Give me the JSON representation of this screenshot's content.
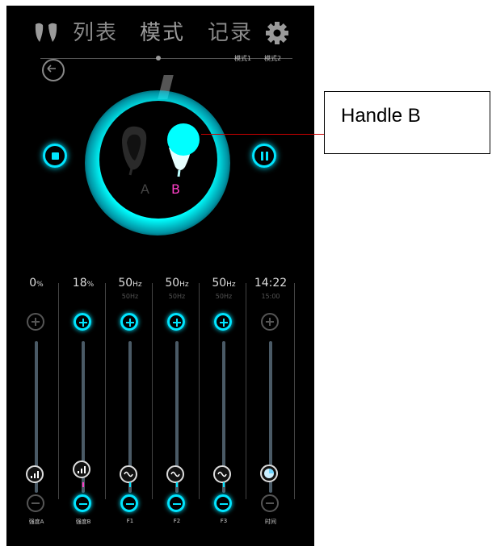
{
  "nav": {
    "tabs": [
      "列表",
      "模式",
      "记录"
    ],
    "active_tab": "模式"
  },
  "modes": [
    "模式1",
    "模式2"
  ],
  "handles": {
    "a": "A",
    "b": "B"
  },
  "colors": {
    "accent": "#00e5ff",
    "handle_b": "#ff3fc8",
    "background": "#000000"
  },
  "icons": {
    "logo": "handles-logo-icon",
    "settings": "gear-icon",
    "back": "back-arrow-icon",
    "stop": "stop-icon",
    "pause": "pause-icon"
  },
  "sliders": [
    {
      "value": "0",
      "unit": "%",
      "sub": "",
      "name": "强度A",
      "active": false,
      "level": 0.0
    },
    {
      "value": "18",
      "unit": "%",
      "sub": "",
      "name": "强度B",
      "active": true,
      "level": 0.18
    },
    {
      "value": "50",
      "unit": "Hz",
      "sub": "50Hz",
      "name": "F1",
      "active": true,
      "level": 0.0
    },
    {
      "value": "50",
      "unit": "Hz",
      "sub": "50Hz",
      "name": "F2",
      "active": true,
      "level": 0.0
    },
    {
      "value": "50",
      "unit": "Hz",
      "sub": "50Hz",
      "name": "F3",
      "active": true,
      "level": 0.0
    },
    {
      "value": "14:22",
      "unit": "",
      "sub": "15:00",
      "name": "时间",
      "active": false,
      "level": 0.04
    }
  ],
  "annotation": {
    "label": "Handle B"
  }
}
